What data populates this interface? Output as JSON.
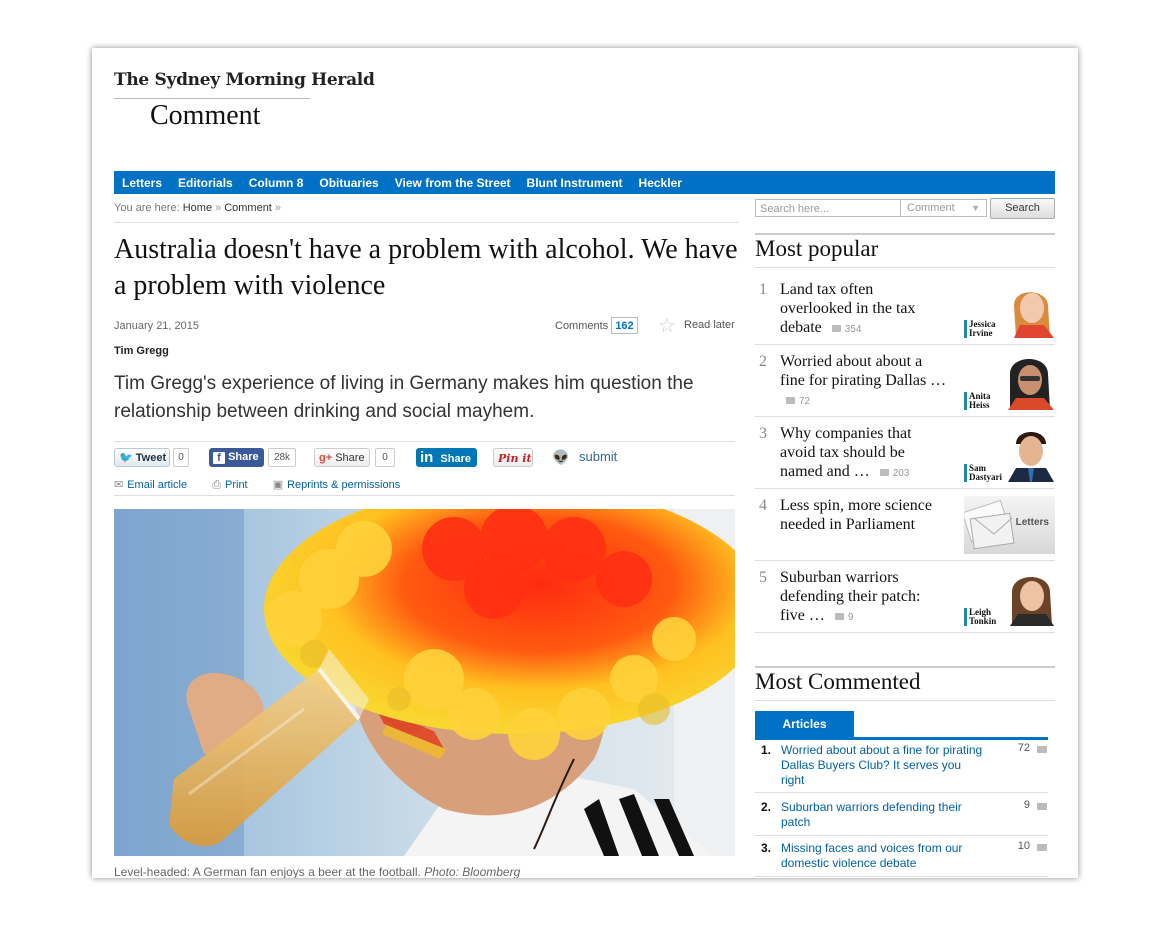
{
  "header": {
    "masthead": "The Sydney Morning Herald",
    "section": "Comment"
  },
  "nav": {
    "items": [
      "Letters",
      "Editorials",
      "Column 8",
      "Obituaries",
      "View from the Street",
      "Blunt Instrument",
      "Heckler"
    ]
  },
  "breadcrumb": {
    "prefix": "You are here:",
    "home": "Home",
    "current": "Comment",
    "separator": "»"
  },
  "search": {
    "placeholder": "Search here...",
    "scope": "Comment",
    "button": "Search"
  },
  "article": {
    "headline": "Australia doesn't have a problem with alcohol. We have a problem with violence",
    "date": "January 21, 2015",
    "comments_label": "Comments",
    "comments_count": "162",
    "read_later": "Read later",
    "byline": "Tim Gregg",
    "standfirst": "Tim Gregg's experience of living in Germany makes him question the relationship between drinking and social mayhem.",
    "caption_text": "Level-headed: A German fan enjoys a beer at the football.",
    "caption_credit": "Photo: Bloomberg"
  },
  "share": {
    "tweet_label": "Tweet",
    "tweet_count": "0",
    "fb_label": "Share",
    "fb_count": "28k",
    "gplus_label": "Share",
    "gplus_count": "0",
    "linkedin_label": "Share",
    "pinit_label": "Pin it",
    "reddit_label": "submit"
  },
  "tools": {
    "email": "Email article",
    "print": "Print",
    "reprints": "Reprints & permissions"
  },
  "most_popular": {
    "heading": "Most popular",
    "items": [
      {
        "num": "1",
        "title": "Land tax often overlooked in the tax debate",
        "count": "354",
        "author": [
          "Jessica",
          "Irvine"
        ]
      },
      {
        "num": "2",
        "title": "Worried about about a fine for pirating Dallas …",
        "count": "72",
        "author": [
          "Anita",
          "Heiss"
        ]
      },
      {
        "num": "3",
        "title": "Why companies that avoid tax should be named and …",
        "count": "203",
        "author": [
          "Sam",
          "Dastyari"
        ]
      },
      {
        "num": "4",
        "title": "Less spin, more science needed in Parliament",
        "count": "",
        "author": [
          "Letters"
        ]
      },
      {
        "num": "5",
        "title": "Suburban warriors defending their patch: five …",
        "count": "9",
        "author": [
          "Leigh",
          "Tonkin"
        ]
      }
    ]
  },
  "most_commented": {
    "heading": "Most Commented",
    "tab": "Articles",
    "items": [
      {
        "num": "1.",
        "title": "Worried about about a fine for pirating Dallas Buyers Club? It serves you right",
        "count": "72"
      },
      {
        "num": "2.",
        "title": "Suburban warriors defending their patch",
        "count": "9"
      },
      {
        "num": "3.",
        "title": "Missing faces and voices from our domestic violence debate",
        "count": "10"
      }
    ]
  },
  "colors": {
    "accent": "#0072c6",
    "link": "#0060a8"
  }
}
